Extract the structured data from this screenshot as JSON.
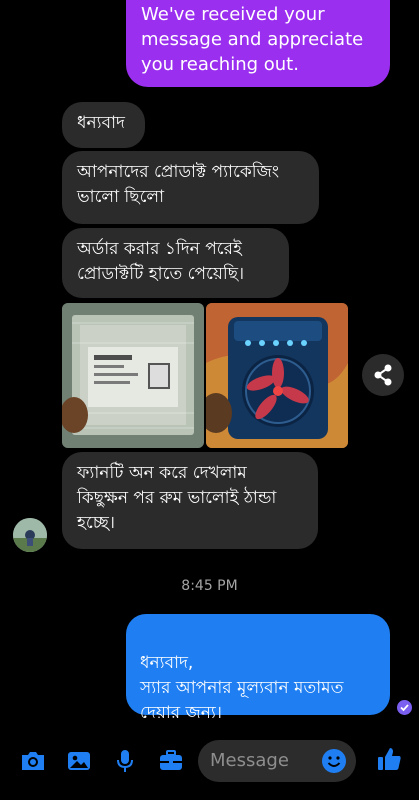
{
  "messages": {
    "outgoing_top": "We've received your message and appreciate you reaching out.",
    "incoming": [
      "ধন্যবাদ",
      "আপনাদের প্রোডাক্ট প্যাকেজিং ভালো ছিলো",
      "অর্ডার করার ১দিন পরেই প্রোডাক্টটি হাতে পেয়েছি।",
      "ফ্যানটি অন করে দেখলাম কিছুক্ষন পর রুম ভালোই ঠান্ডা হচ্ছে।"
    ],
    "timestamp": "8:45 PM",
    "outgoing_reply": "ধন্যবাদ,\nস্যার আপনার মূল্যবান মতামত দেয়ার জন্য।"
  },
  "composer": {
    "placeholder": "Message"
  },
  "icons": [
    "camera-icon",
    "gallery-icon",
    "microphone-icon",
    "toolbox-icon",
    "emoji-icon",
    "thumbs-up-icon",
    "share-icon",
    "check-seen-icon"
  ],
  "colors": {
    "outgoing_purple": "#9b2ff0",
    "outgoing_blue": "#1f7ff2",
    "incoming": "#2b2b2b",
    "background": "#000000"
  }
}
